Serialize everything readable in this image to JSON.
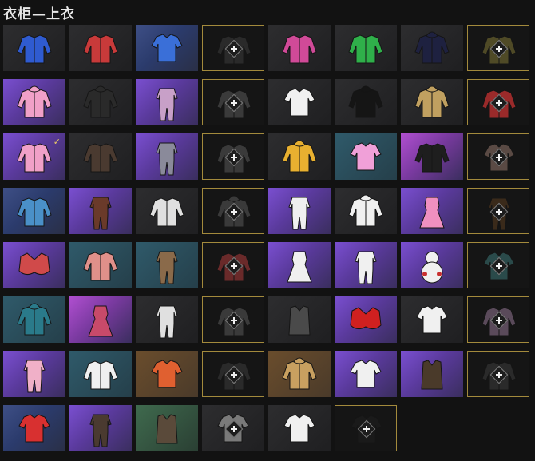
{
  "header": {
    "title": "衣柜—上衣"
  },
  "grid": {
    "slots": [
      {
        "bg": "dark",
        "color": "#2f5bd0",
        "kind": "jacket",
        "locked": false
      },
      {
        "bg": "dark",
        "color": "#c83a3a",
        "kind": "jacket",
        "locked": false
      },
      {
        "bg": "blue",
        "color": "#3a6fd8",
        "kind": "shirt",
        "locked": false
      },
      {
        "bg": "dark",
        "color": "#2a2a2a",
        "kind": "jacket",
        "locked": true
      },
      {
        "bg": "dark",
        "color": "#d04a98",
        "kind": "jacket",
        "locked": false
      },
      {
        "bg": "dark",
        "color": "#2fb04a",
        "kind": "jacket",
        "locked": false
      },
      {
        "bg": "dark",
        "color": "#1e2140",
        "kind": "hoodie",
        "locked": false
      },
      {
        "bg": "dark",
        "color": "#4f4a26",
        "kind": "jacket",
        "locked": true
      },
      {
        "bg": "purple",
        "color": "#f0a0c8",
        "kind": "hoodie",
        "locked": false
      },
      {
        "bg": "dark",
        "color": "#2a2a2a",
        "kind": "hoodie",
        "locked": false
      },
      {
        "bg": "purple",
        "color": "#c8a0c8",
        "kind": "suit",
        "locked": false
      },
      {
        "bg": "orange",
        "color": "#3a3a3a",
        "kind": "jacket",
        "locked": true
      },
      {
        "bg": "dark",
        "color": "#f0f0f0",
        "kind": "shirt",
        "locked": false
      },
      {
        "bg": "dark",
        "color": "#151515",
        "kind": "hoodie",
        "locked": false
      },
      {
        "bg": "dark",
        "color": "#c0a060",
        "kind": "hoodie",
        "locked": false
      },
      {
        "bg": "dark",
        "color": "#9a2a2a",
        "kind": "jacket",
        "locked": true
      },
      {
        "bg": "purple",
        "color": "#f0a0c8",
        "kind": "jacket",
        "locked": false,
        "checked": true
      },
      {
        "bg": "dark",
        "color": "#4a3a30",
        "kind": "jacket",
        "locked": false
      },
      {
        "bg": "purple",
        "color": "#8a8a9a",
        "kind": "suit",
        "locked": false
      },
      {
        "bg": "dark",
        "color": "#3a3a3a",
        "kind": "jacket",
        "locked": true
      },
      {
        "bg": "dark",
        "color": "#e8b030",
        "kind": "hoodie",
        "locked": false
      },
      {
        "bg": "teal",
        "color": "#f0a0d8",
        "kind": "shirt",
        "locked": false
      },
      {
        "bg": "pink",
        "color": "#1e1e1e",
        "kind": "jacket",
        "locked": false
      },
      {
        "bg": "dark",
        "color": "#5a4a44",
        "kind": "shirt",
        "locked": true
      },
      {
        "bg": "blue",
        "color": "#4a90c8",
        "kind": "jacket",
        "locked": false
      },
      {
        "bg": "purple",
        "color": "#6a3a2a",
        "kind": "suit",
        "locked": false
      },
      {
        "bg": "dark",
        "color": "#e0e0e0",
        "kind": "jacket",
        "locked": false
      },
      {
        "bg": "dark",
        "color": "#3a3a3a",
        "kind": "hoodie",
        "locked": true
      },
      {
        "bg": "purple",
        "color": "#f0f0f0",
        "kind": "suit",
        "locked": false
      },
      {
        "bg": "dark",
        "color": "#f0f0f0",
        "kind": "hoodie",
        "locked": false
      },
      {
        "bg": "purple",
        "color": "#f090c0",
        "kind": "dress",
        "locked": false
      },
      {
        "bg": "dark",
        "color": "#3a2a1a",
        "kind": "suit",
        "locked": true
      },
      {
        "bg": "purple",
        "color": "#d04a4a",
        "kind": "bra",
        "locked": false
      },
      {
        "bg": "teal",
        "color": "#e0908a",
        "kind": "jacket",
        "locked": false
      },
      {
        "bg": "teal",
        "color": "#8a6a4a",
        "kind": "suit",
        "locked": false
      },
      {
        "bg": "dark",
        "color": "#6a2a2a",
        "kind": "jacket",
        "locked": true
      },
      {
        "bg": "purple",
        "color": "#f0f0f0",
        "kind": "dress",
        "locked": false
      },
      {
        "bg": "purple",
        "color": "#f0f0f0",
        "kind": "suit",
        "locked": false
      },
      {
        "bg": "purple",
        "color": "#f0f0f0",
        "kind": "snowman",
        "locked": false
      },
      {
        "bg": "green",
        "color": "#2a4a4a",
        "kind": "shirt",
        "locked": true
      },
      {
        "bg": "teal",
        "color": "#2a7a8a",
        "kind": "hoodie",
        "locked": false
      },
      {
        "bg": "pink",
        "color": "#c84a6a",
        "kind": "dress",
        "locked": false
      },
      {
        "bg": "dark",
        "color": "#e0e0e0",
        "kind": "suit",
        "locked": false
      },
      {
        "bg": "dark",
        "color": "#3a3a3a",
        "kind": "jacket",
        "locked": true
      },
      {
        "bg": "dark",
        "color": "#4a4a4a",
        "kind": "vest",
        "locked": false
      },
      {
        "bg": "purple",
        "color": "#d02020",
        "kind": "bra",
        "locked": false
      },
      {
        "bg": "dark",
        "color": "#f0f0f0",
        "kind": "shirt",
        "locked": false
      },
      {
        "bg": "dark",
        "color": "#5a4a5a",
        "kind": "jacket",
        "locked": true
      },
      {
        "bg": "purple",
        "color": "#f0b0c8",
        "kind": "suit",
        "locked": false
      },
      {
        "bg": "teal",
        "color": "#f0f0f0",
        "kind": "jacket",
        "locked": false
      },
      {
        "bg": "orange",
        "color": "#e06030",
        "kind": "shirt",
        "locked": false
      },
      {
        "bg": "dark",
        "color": "#2a2a2a",
        "kind": "jacket",
        "locked": true
      },
      {
        "bg": "orange",
        "color": "#c8a060",
        "kind": "hoodie",
        "locked": false
      },
      {
        "bg": "purple",
        "color": "#f0f0f0",
        "kind": "shirt",
        "locked": false
      },
      {
        "bg": "purple",
        "color": "#4a3a2a",
        "kind": "vest",
        "locked": false
      },
      {
        "bg": "dark",
        "color": "#2a2a2a",
        "kind": "jacket",
        "locked": true
      },
      {
        "bg": "blue",
        "color": "#d83030",
        "kind": "shirt",
        "locked": false
      },
      {
        "bg": "purple",
        "color": "#4a3a30",
        "kind": "suit",
        "locked": false
      },
      {
        "bg": "green",
        "color": "#5a4a3a",
        "kind": "vest",
        "locked": false
      },
      {
        "bg": "dark",
        "color": "#7a7a7a",
        "kind": "shirt",
        "locked": false,
        "plus": true
      },
      {
        "bg": "dark",
        "color": "#f0f0f0",
        "kind": "shirt",
        "locked": false
      },
      {
        "bg": "dark",
        "color": "#1a1a1a",
        "kind": "shirt",
        "locked": true
      }
    ]
  }
}
